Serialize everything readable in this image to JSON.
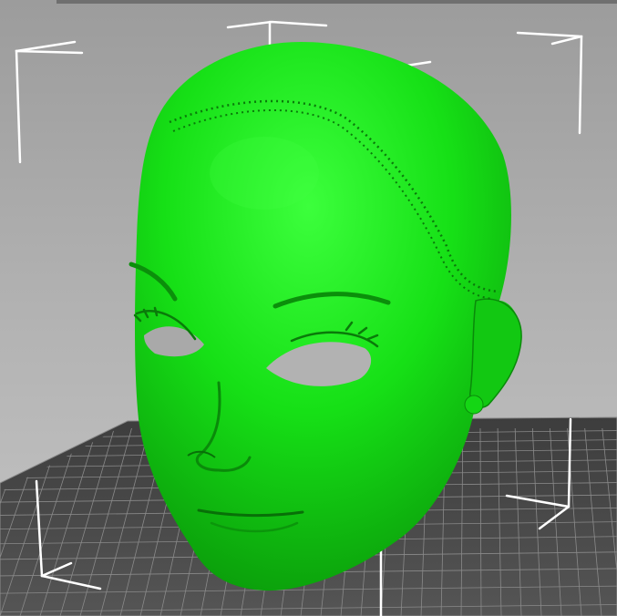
{
  "app": {
    "view": "3d-viewport"
  },
  "colors": {
    "background_top": "#9c9c9c",
    "background_bottom": "#c4c4c4",
    "bed": "#4a4a4a",
    "grid_line": "#8a8a8a",
    "model": "#16e016",
    "model_shadow": "#0a9a0a",
    "model_highlight": "#3cff3c",
    "bounding_box": "#ffffff"
  },
  "objects": {
    "model": {
      "name": "face-mask-model",
      "selected": true
    },
    "bed": {
      "name": "print-bed-grid"
    },
    "bounds": {
      "name": "selection-bounding-box"
    }
  }
}
